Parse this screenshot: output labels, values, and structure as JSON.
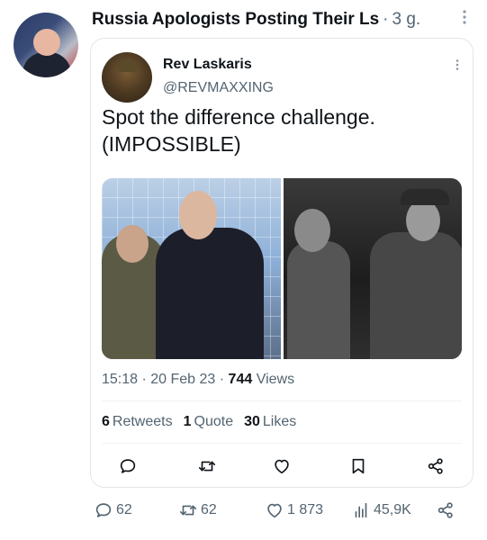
{
  "post": {
    "author": "Russia Apologists Posting Their Ls",
    "separator": "·",
    "time": "3 g.",
    "more_icon": "more-vertical-icon"
  },
  "quoted": {
    "name": "Rev Laskaris",
    "handle": "@REVMAXXING",
    "text": "Spot the difference challenge. (IMPOSSIBLE)",
    "timestamp": "15:18 · 20 Feb 23 ·",
    "views_count": "744",
    "views_label": "Views",
    "retweets_count": "6",
    "retweets_label": "Retweets",
    "quote_count": "1",
    "quote_label": "Quote",
    "likes_count": "30",
    "likes_label": "Likes"
  },
  "quoted_actions": [
    "reply-icon",
    "retweet-icon",
    "like-icon",
    "bookmark-icon",
    "share-icon"
  ],
  "bottom_bar": {
    "replies": "62",
    "retweets": "62",
    "likes": "1 873",
    "views": "45,9K"
  },
  "colors": {
    "text": "#0f1419",
    "muted": "#536471",
    "border": "#e1e6ea"
  }
}
